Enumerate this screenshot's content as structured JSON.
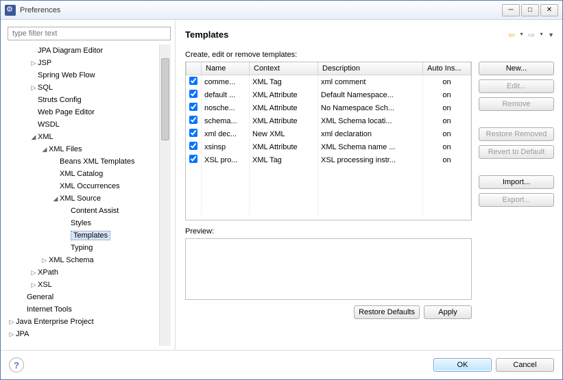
{
  "window": {
    "title": "Preferences"
  },
  "filter": {
    "placeholder": "type filter text"
  },
  "tree": [
    {
      "label": "JPA Diagram Editor",
      "indent": 2,
      "tw": ""
    },
    {
      "label": "JSP",
      "indent": 2,
      "tw": "▷"
    },
    {
      "label": "Spring Web Flow",
      "indent": 2,
      "tw": ""
    },
    {
      "label": "SQL",
      "indent": 2,
      "tw": "▷"
    },
    {
      "label": "Struts Config",
      "indent": 2,
      "tw": ""
    },
    {
      "label": "Web Page Editor",
      "indent": 2,
      "tw": ""
    },
    {
      "label": "WSDL",
      "indent": 2,
      "tw": ""
    },
    {
      "label": "XML",
      "indent": 2,
      "tw": "◢"
    },
    {
      "label": "XML Files",
      "indent": 3,
      "tw": "◢"
    },
    {
      "label": "Beans XML Templates",
      "indent": 4,
      "tw": ""
    },
    {
      "label": "XML Catalog",
      "indent": 4,
      "tw": ""
    },
    {
      "label": "XML Occurrences",
      "indent": 4,
      "tw": ""
    },
    {
      "label": "XML Source",
      "indent": 4,
      "tw": "◢"
    },
    {
      "label": "Content Assist",
      "indent": 5,
      "tw": ""
    },
    {
      "label": "Styles",
      "indent": 5,
      "tw": ""
    },
    {
      "label": "Templates",
      "indent": 5,
      "tw": "",
      "selected": true
    },
    {
      "label": "Typing",
      "indent": 5,
      "tw": ""
    },
    {
      "label": "XML Schema",
      "indent": 3,
      "tw": "▷"
    },
    {
      "label": "XPath",
      "indent": 2,
      "tw": "▷"
    },
    {
      "label": "XSL",
      "indent": 2,
      "tw": "▷"
    },
    {
      "label": "General",
      "indent": 1,
      "tw": ""
    },
    {
      "label": "Internet Tools",
      "indent": 1,
      "tw": ""
    },
    {
      "label": "Java Enterprise Project",
      "indent": 0,
      "tw": "▷"
    },
    {
      "label": "JPA",
      "indent": 0,
      "tw": "▷"
    }
  ],
  "page": {
    "title": "Templates",
    "subtitle": "Create, edit or remove templates:",
    "previewLabel": "Preview:"
  },
  "columns": {
    "name": "Name",
    "context": "Context",
    "description": "Description",
    "auto": "Auto Ins..."
  },
  "rows": [
    {
      "checked": true,
      "name": "comme...",
      "context": "XML Tag",
      "desc": "xml comment",
      "auto": "on"
    },
    {
      "checked": true,
      "name": "default ...",
      "context": "XML Attribute",
      "desc": "Default Namespace...",
      "auto": "on"
    },
    {
      "checked": true,
      "name": "nosche...",
      "context": "XML Attribute",
      "desc": "No Namespace Sch...",
      "auto": "on"
    },
    {
      "checked": true,
      "name": "schema...",
      "context": "XML Attribute",
      "desc": "XML Schema locati...",
      "auto": "on"
    },
    {
      "checked": true,
      "name": "xml dec...",
      "context": "New XML",
      "desc": "xml declaration",
      "auto": "on"
    },
    {
      "checked": true,
      "name": "xsinsp",
      "context": "XML Attribute",
      "desc": "XML Schema name ...",
      "auto": "on"
    },
    {
      "checked": true,
      "name": "XSL pro...",
      "context": "XML Tag",
      "desc": "XSL processing instr...",
      "auto": "on"
    }
  ],
  "buttons": {
    "new": "New...",
    "edit": "Edit...",
    "remove": "Remove",
    "restoreRemoved": "Restore Removed",
    "revert": "Revert to Default",
    "import": "Import...",
    "export": "Export...",
    "restoreDefaults": "Restore Defaults",
    "apply": "Apply",
    "ok": "OK",
    "cancel": "Cancel"
  }
}
